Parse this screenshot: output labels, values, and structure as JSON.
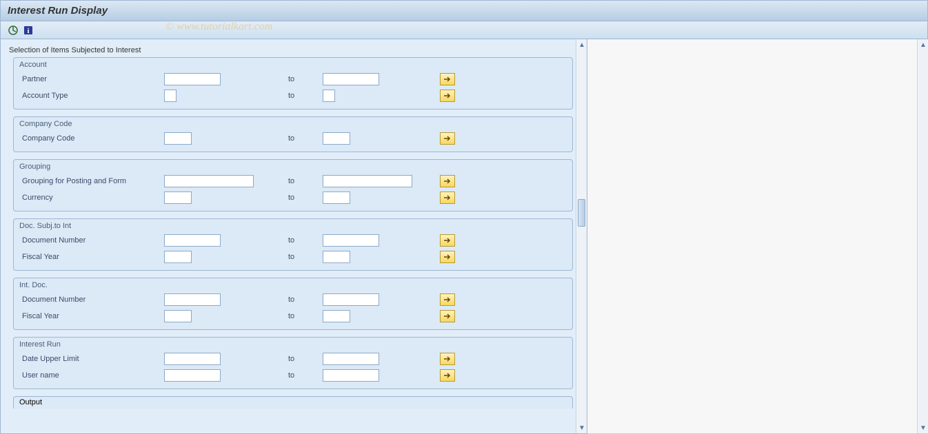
{
  "title": "Interest Run Display",
  "watermark": "© www.tutorialkart.com",
  "section_header": "Selection of Items Subjected to Interest",
  "labels": {
    "to": "to"
  },
  "groups": {
    "account": {
      "legend": "Account",
      "partner_label": "Partner",
      "account_type_label": "Account Type"
    },
    "company_code": {
      "legend": "Company Code",
      "company_code_label": "Company Code"
    },
    "grouping": {
      "legend": "Grouping",
      "posting_form_label": "Grouping for Posting and Form",
      "currency_label": "Currency"
    },
    "doc_subj": {
      "legend": "Doc. Subj.to Int",
      "doc_number_label": "Document Number",
      "fiscal_year_label": "Fiscal Year"
    },
    "int_doc": {
      "legend": "Int. Doc.",
      "doc_number_label": "Document Number",
      "fiscal_year_label": "Fiscal Year"
    },
    "interest_run": {
      "legend": "Interest Run",
      "date_upper_label": "Date Upper Limit",
      "user_name_label": "User name"
    },
    "output": {
      "legend": "Output"
    }
  }
}
